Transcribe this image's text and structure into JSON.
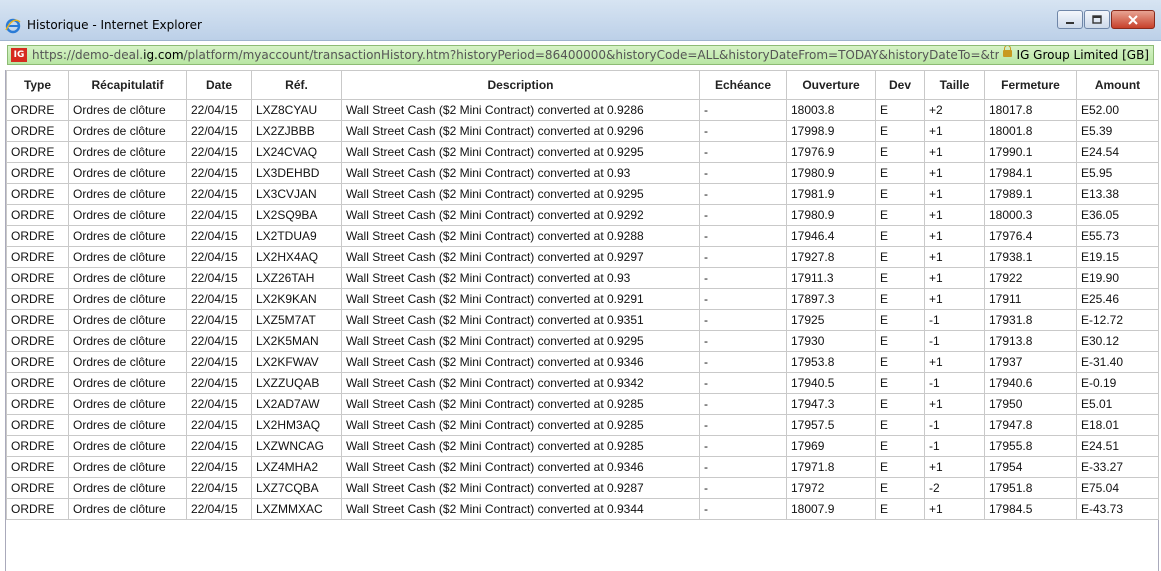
{
  "window": {
    "title": "Historique - Internet Explorer",
    "url_prefix": "https://demo-deal.",
    "url_domain": "ig.com",
    "url_rest": "/platform/myaccount/transactionHistory.htm?historyPeriod=86400000&historyCode=ALL&historyDateFrom=TODAY&historyDateTo=&transactionHistoryPag",
    "security_label": "IG Group Limited [GB]",
    "logo_text": "IG"
  },
  "table": {
    "headers": [
      "Type",
      "Récapitulatif",
      "Date",
      "Réf.",
      "Description",
      "Echéance",
      "Ouverture",
      "Dev",
      "Taille",
      "Fermeture",
      "Amount"
    ],
    "rows": [
      [
        "ORDRE",
        "Ordres de clôture",
        "22/04/15",
        "LXZ8CYAU",
        "Wall Street Cash ($2 Mini Contract) converted at 0.9286",
        "-",
        "18003.8",
        "E",
        "+2",
        "18017.8",
        "E52.00"
      ],
      [
        "ORDRE",
        "Ordres de clôture",
        "22/04/15",
        "LX2ZJBBB",
        "Wall Street Cash ($2 Mini Contract) converted at 0.9296",
        "-",
        "17998.9",
        "E",
        "+1",
        "18001.8",
        "E5.39"
      ],
      [
        "ORDRE",
        "Ordres de clôture",
        "22/04/15",
        "LX24CVAQ",
        "Wall Street Cash ($2 Mini Contract) converted at 0.9295",
        "-",
        "17976.9",
        "E",
        "+1",
        "17990.1",
        "E24.54"
      ],
      [
        "ORDRE",
        "Ordres de clôture",
        "22/04/15",
        "LX3DEHBD",
        "Wall Street Cash ($2 Mini Contract) converted at 0.93",
        "-",
        "17980.9",
        "E",
        "+1",
        "17984.1",
        "E5.95"
      ],
      [
        "ORDRE",
        "Ordres de clôture",
        "22/04/15",
        "LX3CVJAN",
        "Wall Street Cash ($2 Mini Contract) converted at 0.9295",
        "-",
        "17981.9",
        "E",
        "+1",
        "17989.1",
        "E13.38"
      ],
      [
        "ORDRE",
        "Ordres de clôture",
        "22/04/15",
        "LX2SQ9BA",
        "Wall Street Cash ($2 Mini Contract) converted at 0.9292",
        "-",
        "17980.9",
        "E",
        "+1",
        "18000.3",
        "E36.05"
      ],
      [
        "ORDRE",
        "Ordres de clôture",
        "22/04/15",
        "LX2TDUA9",
        "Wall Street Cash ($2 Mini Contract) converted at 0.9288",
        "-",
        "17946.4",
        "E",
        "+1",
        "17976.4",
        "E55.73"
      ],
      [
        "ORDRE",
        "Ordres de clôture",
        "22/04/15",
        "LX2HX4AQ",
        "Wall Street Cash ($2 Mini Contract) converted at 0.9297",
        "-",
        "17927.8",
        "E",
        "+1",
        "17938.1",
        "E19.15"
      ],
      [
        "ORDRE",
        "Ordres de clôture",
        "22/04/15",
        "LXZ26TAH",
        "Wall Street Cash ($2 Mini Contract) converted at 0.93",
        "-",
        "17911.3",
        "E",
        "+1",
        "17922",
        "E19.90"
      ],
      [
        "ORDRE",
        "Ordres de clôture",
        "22/04/15",
        "LX2K9KAN",
        "Wall Street Cash ($2 Mini Contract) converted at 0.9291",
        "-",
        "17897.3",
        "E",
        "+1",
        "17911",
        "E25.46"
      ],
      [
        "ORDRE",
        "Ordres de clôture",
        "22/04/15",
        "LXZ5M7AT",
        "Wall Street Cash ($2 Mini Contract) converted at 0.9351",
        "-",
        "17925",
        "E",
        "-1",
        "17931.8",
        "E-12.72"
      ],
      [
        "ORDRE",
        "Ordres de clôture",
        "22/04/15",
        "LX2K5MAN",
        "Wall Street Cash ($2 Mini Contract) converted at 0.9295",
        "-",
        "17930",
        "E",
        "-1",
        "17913.8",
        "E30.12"
      ],
      [
        "ORDRE",
        "Ordres de clôture",
        "22/04/15",
        "LX2KFWAV",
        "Wall Street Cash ($2 Mini Contract) converted at 0.9346",
        "-",
        "17953.8",
        "E",
        "+1",
        "17937",
        "E-31.40"
      ],
      [
        "ORDRE",
        "Ordres de clôture",
        "22/04/15",
        "LXZZUQAB",
        "Wall Street Cash ($2 Mini Contract) converted at 0.9342",
        "-",
        "17940.5",
        "E",
        "-1",
        "17940.6",
        "E-0.19"
      ],
      [
        "ORDRE",
        "Ordres de clôture",
        "22/04/15",
        "LX2AD7AW",
        "Wall Street Cash ($2 Mini Contract) converted at 0.9285",
        "-",
        "17947.3",
        "E",
        "+1",
        "17950",
        "E5.01"
      ],
      [
        "ORDRE",
        "Ordres de clôture",
        "22/04/15",
        "LX2HM3AQ",
        "Wall Street Cash ($2 Mini Contract) converted at 0.9285",
        "-",
        "17957.5",
        "E",
        "-1",
        "17947.8",
        "E18.01"
      ],
      [
        "ORDRE",
        "Ordres de clôture",
        "22/04/15",
        "LXZWNCAG",
        "Wall Street Cash ($2 Mini Contract) converted at 0.9285",
        "-",
        "17969",
        "E",
        "-1",
        "17955.8",
        "E24.51"
      ],
      [
        "ORDRE",
        "Ordres de clôture",
        "22/04/15",
        "LXZ4MHA2",
        "Wall Street Cash ($2 Mini Contract) converted at 0.9346",
        "-",
        "17971.8",
        "E",
        "+1",
        "17954",
        "E-33.27"
      ],
      [
        "ORDRE",
        "Ordres de clôture",
        "22/04/15",
        "LXZ7CQBA",
        "Wall Street Cash ($2 Mini Contract) converted at 0.9287",
        "-",
        "17972",
        "E",
        "-2",
        "17951.8",
        "E75.04"
      ],
      [
        "ORDRE",
        "Ordres de clôture",
        "22/04/15",
        "LXZMMXAC",
        "Wall Street Cash ($2 Mini Contract) converted at 0.9344",
        "-",
        "18007.9",
        "E",
        "+1",
        "17984.5",
        "E-43.73"
      ]
    ]
  },
  "icons": {
    "title": "ie-logo-icon",
    "minimize": "minimize-icon",
    "maximize": "maximize-icon",
    "close": "close-icon",
    "site": "ig-logo-icon",
    "security": "lock-icon"
  },
  "colors": {
    "address_bar": "#c8ecb4",
    "close_button": "#c7402a",
    "ig_brand": "#d62b1f"
  }
}
